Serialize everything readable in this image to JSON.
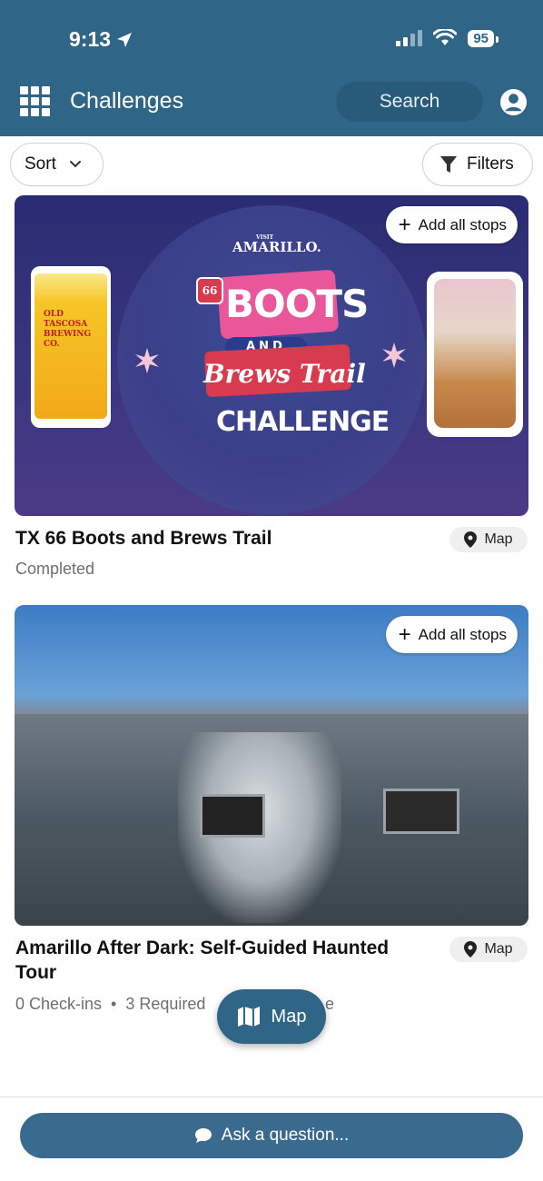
{
  "status_bar": {
    "time": "9:13",
    "battery": "95"
  },
  "header": {
    "title": "Challenges",
    "search_label": "Search"
  },
  "toolbar": {
    "sort_label": "Sort",
    "filters_label": "Filters"
  },
  "cards": [
    {
      "title": "TX 66 Boots and Brews Trail",
      "subtitle": "Completed",
      "add_stops_label": "Add all stops",
      "map_label": "Map",
      "image_text": {
        "visit": "VISIT",
        "brand": "AMARILLO.",
        "route": "66",
        "line1": "BOOTS",
        "line2": "AND",
        "line3": "Brews Trail",
        "line4": "CHALLENGE",
        "beer_label": "OLD TASCOSA BREWING CO."
      }
    },
    {
      "title": "Amarillo After Dark: Self-Guided Haunted Tour",
      "subtitle": "0 Check-ins  •  3 Required",
      "subtitle_tail": "e",
      "add_stops_label": "Add all stops",
      "map_label": "Map"
    }
  ],
  "floating_map_label": "Map",
  "ask_button_label": "Ask a question..."
}
